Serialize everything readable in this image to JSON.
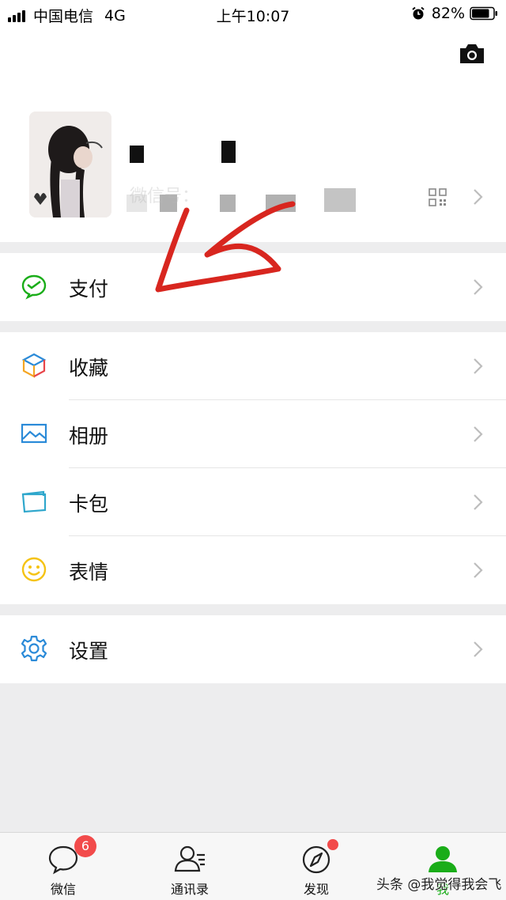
{
  "status_bar": {
    "carrier": "中国电信",
    "network": "4G",
    "time": "上午10:07",
    "battery": "82%"
  },
  "profile": {
    "name": "■     ˘ ¨ ■",
    "wechat_id_label": "微信号："
  },
  "menu": {
    "pay": "支付",
    "favorites": "收藏",
    "album": "相册",
    "cards": "卡包",
    "stickers": "表情",
    "settings": "设置"
  },
  "tabs": [
    {
      "label": "微信",
      "badge": "6"
    },
    {
      "label": "通讯录"
    },
    {
      "label": "发现"
    },
    {
      "label": "我"
    }
  ],
  "watermark": "头条 @我觉得我会飞",
  "colors": {
    "active_green": "#1aad19",
    "pay_icon": "#1aad19",
    "album_icon": "#2a8ad8",
    "cards_icon": "#2fa7cc",
    "stickers_icon": "#f5c314",
    "settings_icon": "#2a8ad8",
    "badge_red": "#f24b4b",
    "annotation_red": "#d8261f"
  }
}
